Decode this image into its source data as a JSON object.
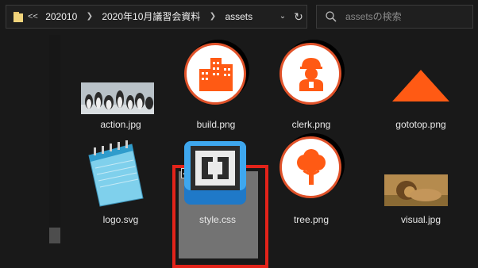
{
  "address_bar": {
    "overflow": "<<",
    "crumbs": [
      "202010",
      "2020年10月議習会資料",
      "assets"
    ]
  },
  "search": {
    "placeholder": "assetsの検索",
    "value": ""
  },
  "files": [
    {
      "name": "action.jpg",
      "kind": "photo"
    },
    {
      "name": "build.png",
      "kind": "icon"
    },
    {
      "name": "clerk.png",
      "kind": "icon"
    },
    {
      "name": "gototop.png",
      "kind": "triangle"
    },
    {
      "name": "logo.svg",
      "kind": "notepad"
    },
    {
      "name": "style.css",
      "kind": "brackets",
      "selected": true,
      "checked": true
    },
    {
      "name": "tree.png",
      "kind": "icon"
    },
    {
      "name": "visual.jpg",
      "kind": "photo"
    }
  ],
  "colors": {
    "accent_orange": "#ff5a14",
    "selection_outline": "#e2231a",
    "folder": "#f0d47c",
    "background": "#191919"
  },
  "icons": {
    "folder": "folder-icon",
    "chevron": "chevron-right-icon",
    "dropdown": "chevron-down-icon",
    "refresh": "refresh-icon",
    "search": "search-icon",
    "check": "check-icon"
  }
}
